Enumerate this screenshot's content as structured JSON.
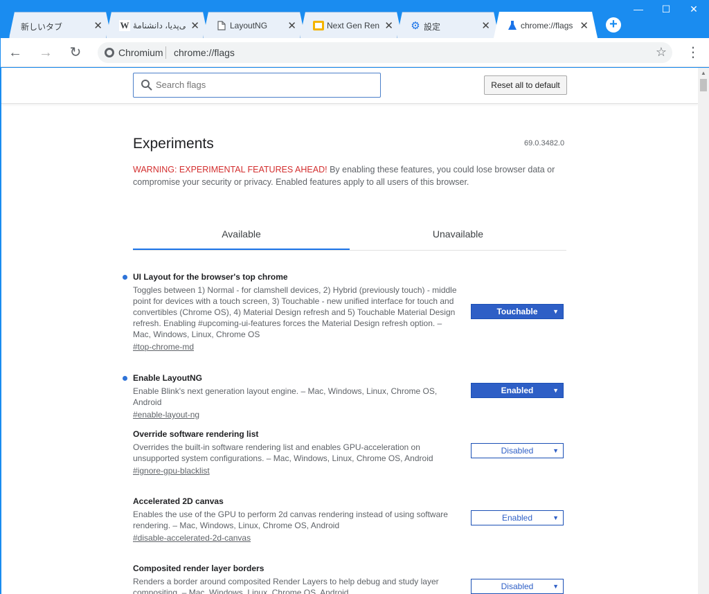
{
  "window": {
    "minimize": "—",
    "maximize": "☐",
    "close": "✕"
  },
  "tabs": [
    {
      "title": "新しいタブ",
      "favicon": "blank-icon"
    },
    {
      "title": "ویکی‌پدیا، دانشنامهٔ",
      "favicon": "wikipedia-icon"
    },
    {
      "title": "LayoutNG",
      "favicon": "document-icon"
    },
    {
      "title": "Next Gen Rendering",
      "favicon": "slides-icon"
    },
    {
      "title": "設定",
      "favicon": "gear-icon"
    },
    {
      "title": "chrome://flags",
      "favicon": "flask-icon"
    }
  ],
  "toolbar": {
    "origin": "Chromium",
    "url": "chrome://flags"
  },
  "search": {
    "placeholder": "Search flags"
  },
  "reset_label": "Reset all to default",
  "page": {
    "heading": "Experiments",
    "version": "69.0.3482.0",
    "warning_red": "WARNING: EXPERIMENTAL FEATURES AHEAD!",
    "warning_text": " By enabling these features, you could lose browser data or compromise your security or privacy. Enabled features apply to all users of this browser."
  },
  "panel_tabs": {
    "available": "Available",
    "unavailable": "Unavailable"
  },
  "experiments": [
    {
      "name": "UI Layout for the browser's top chrome",
      "desc": "Toggles between 1) Normal - for clamshell devices, 2) Hybrid (previously touch) - middle point for devices with a touch screen, 3) Touchable - new unified interface for touch and convertibles (Chrome OS), 4) Material Design refresh and 5) Touchable Material Design refresh. Enabling #upcoming-ui-features forces the Material Design refresh option. – Mac, Windows, Linux, Chrome OS",
      "link": "#top-chrome-md",
      "value": "Touchable",
      "modified": true
    },
    {
      "name": "Enable LayoutNG",
      "desc": "Enable Blink's next generation layout engine. – Mac, Windows, Linux, Chrome OS, Android",
      "link": "#enable-layout-ng",
      "value": "Enabled",
      "modified": true
    },
    {
      "name": "Override software rendering list",
      "desc": "Overrides the built-in software rendering list and enables GPU-acceleration on unsupported system configurations. – Mac, Windows, Linux, Chrome OS, Android",
      "link": "#ignore-gpu-blacklist",
      "value": "Disabled",
      "modified": false
    },
    {
      "name": "Accelerated 2D canvas",
      "desc": "Enables the use of the GPU to perform 2d canvas rendering instead of using software rendering. – Mac, Windows, Linux, Chrome OS, Android",
      "link": "#disable-accelerated-2d-canvas",
      "value": "Enabled",
      "modified": false
    },
    {
      "name": "Composited render layer borders",
      "desc": "Renders a border around composited Render Layers to help debug and study layer compositing. – Mac, Windows, Linux, Chrome OS, Android",
      "link": "",
      "value": "Disabled",
      "modified": false
    }
  ],
  "colors": {
    "titlebar": "#1a8cf0",
    "accent": "#2e5fc6",
    "warning": "#d32f2f"
  }
}
